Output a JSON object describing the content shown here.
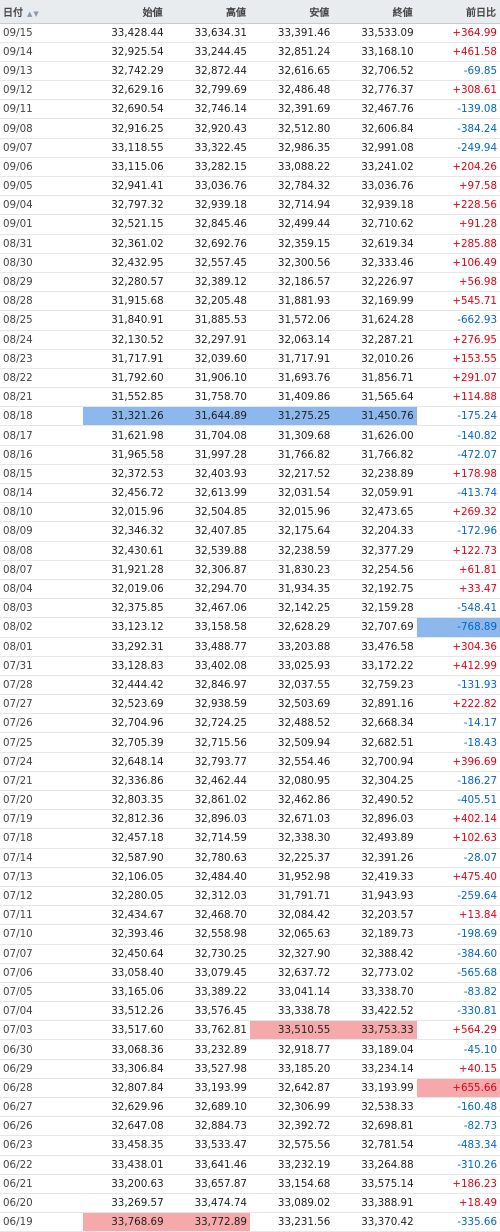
{
  "header": {
    "date": "日付",
    "open": "始値",
    "high": "高値",
    "low": "安値",
    "close": "終値",
    "change": "前日比"
  },
  "rows": [
    {
      "date": "09/15",
      "open": "33,428.44",
      "high": "33,634.31",
      "low": "33,391.46",
      "close": "33,533.09",
      "change": "+364.99"
    },
    {
      "date": "09/14",
      "open": "32,925.54",
      "high": "33,244.45",
      "low": "32,851.24",
      "close": "33,168.10",
      "change": "+461.58"
    },
    {
      "date": "09/13",
      "open": "32,742.29",
      "high": "32,872.44",
      "low": "32,616.65",
      "close": "32,706.52",
      "change": "-69.85"
    },
    {
      "date": "09/12",
      "open": "32,629.16",
      "high": "32,799.69",
      "low": "32,486.48",
      "close": "32,776.37",
      "change": "+308.61"
    },
    {
      "date": "09/11",
      "open": "32,690.54",
      "high": "32,746.14",
      "low": "32,391.69",
      "close": "32,467.76",
      "change": "-139.08"
    },
    {
      "date": "09/08",
      "open": "32,916.25",
      "high": "32,920.43",
      "low": "32,512.80",
      "close": "32,606.84",
      "change": "-384.24"
    },
    {
      "date": "09/07",
      "open": "33,118.55",
      "high": "33,322.45",
      "low": "32,986.35",
      "close": "32,991.08",
      "change": "-249.94"
    },
    {
      "date": "09/06",
      "open": "33,115.06",
      "high": "33,282.15",
      "low": "33,088.22",
      "close": "33,241.02",
      "change": "+204.26"
    },
    {
      "date": "09/05",
      "open": "32,941.41",
      "high": "33,036.76",
      "low": "32,784.32",
      "close": "33,036.76",
      "change": "+97.58"
    },
    {
      "date": "09/04",
      "open": "32,797.32",
      "high": "32,939.18",
      "low": "32,714.94",
      "close": "32,939.18",
      "change": "+228.56"
    },
    {
      "date": "09/01",
      "open": "32,521.15",
      "high": "32,845.46",
      "low": "32,499.44",
      "close": "32,710.62",
      "change": "+91.28"
    },
    {
      "date": "08/31",
      "open": "32,361.02",
      "high": "32,692.76",
      "low": "32,359.15",
      "close": "32,619.34",
      "change": "+285.88"
    },
    {
      "date": "08/30",
      "open": "32,432.95",
      "high": "32,557.45",
      "low": "32,300.56",
      "close": "32,333.46",
      "change": "+106.49"
    },
    {
      "date": "08/29",
      "open": "32,280.57",
      "high": "32,389.12",
      "low": "32,186.57",
      "close": "32,226.97",
      "change": "+56.98"
    },
    {
      "date": "08/28",
      "open": "31,915.68",
      "high": "32,205.48",
      "low": "31,881.93",
      "close": "32,169.99",
      "change": "+545.71"
    },
    {
      "date": "08/25",
      "open": "31,840.91",
      "high": "31,885.53",
      "low": "31,572.06",
      "close": "31,624.28",
      "change": "-662.93"
    },
    {
      "date": "08/24",
      "open": "32,130.52",
      "high": "32,297.91",
      "low": "32,063.14",
      "close": "32,287.21",
      "change": "+276.95"
    },
    {
      "date": "08/23",
      "open": "31,717.91",
      "high": "32,039.60",
      "low": "31,717.91",
      "close": "32,010.26",
      "change": "+153.55"
    },
    {
      "date": "08/22",
      "open": "31,792.60",
      "high": "31,906.10",
      "low": "31,693.76",
      "close": "31,856.71",
      "change": "+291.07"
    },
    {
      "date": "08/21",
      "open": "31,552.85",
      "high": "31,758.70",
      "low": "31,409.86",
      "close": "31,565.64",
      "change": "+114.88"
    },
    {
      "date": "08/18",
      "open": "31,321.26",
      "high": "31,644.89",
      "low": "31,275.25",
      "close": "31,450.76",
      "change": "-175.24",
      "hl": "blue",
      "hlcols": [
        "open",
        "high",
        "low",
        "close"
      ]
    },
    {
      "date": "08/17",
      "open": "31,621.98",
      "high": "31,704.08",
      "low": "31,309.68",
      "close": "31,626.00",
      "change": "-140.82"
    },
    {
      "date": "08/16",
      "open": "31,965.58",
      "high": "31,997.28",
      "low": "31,766.82",
      "close": "31,766.82",
      "change": "-472.07"
    },
    {
      "date": "08/15",
      "open": "32,372.53",
      "high": "32,403.93",
      "low": "32,217.52",
      "close": "32,238.89",
      "change": "+178.98"
    },
    {
      "date": "08/14",
      "open": "32,456.72",
      "high": "32,613.99",
      "low": "32,031.54",
      "close": "32,059.91",
      "change": "-413.74"
    },
    {
      "date": "08/10",
      "open": "32,015.96",
      "high": "32,504.85",
      "low": "32,015.96",
      "close": "32,473.65",
      "change": "+269.32"
    },
    {
      "date": "08/09",
      "open": "32,346.32",
      "high": "32,407.85",
      "low": "32,175.64",
      "close": "32,204.33",
      "change": "-172.96"
    },
    {
      "date": "08/08",
      "open": "32,430.61",
      "high": "32,539.88",
      "low": "32,238.59",
      "close": "32,377.29",
      "change": "+122.73"
    },
    {
      "date": "08/07",
      "open": "31,921.28",
      "high": "32,306.87",
      "low": "31,830.23",
      "close": "32,254.56",
      "change": "+61.81"
    },
    {
      "date": "08/04",
      "open": "32,019.06",
      "high": "32,294.70",
      "low": "31,934.35",
      "close": "32,192.75",
      "change": "+33.47"
    },
    {
      "date": "08/03",
      "open": "32,375.85",
      "high": "32,467.06",
      "low": "32,142.25",
      "close": "32,159.28",
      "change": "-548.41"
    },
    {
      "date": "08/02",
      "open": "33,123.12",
      "high": "33,158.58",
      "low": "32,628.29",
      "close": "32,707.69",
      "change": "-768.89",
      "hl": "blue",
      "hlcols": [
        "change"
      ]
    },
    {
      "date": "08/01",
      "open": "33,292.31",
      "high": "33,488.77",
      "low": "33,203.88",
      "close": "33,476.58",
      "change": "+304.36"
    },
    {
      "date": "07/31",
      "open": "33,128.83",
      "high": "33,402.08",
      "low": "33,025.93",
      "close": "33,172.22",
      "change": "+412.99"
    },
    {
      "date": "07/28",
      "open": "32,444.42",
      "high": "32,846.97",
      "low": "32,037.55",
      "close": "32,759.23",
      "change": "-131.93"
    },
    {
      "date": "07/27",
      "open": "32,523.69",
      "high": "32,938.59",
      "low": "32,503.69",
      "close": "32,891.16",
      "change": "+222.82"
    },
    {
      "date": "07/26",
      "open": "32,704.96",
      "high": "32,724.25",
      "low": "32,488.52",
      "close": "32,668.34",
      "change": "-14.17"
    },
    {
      "date": "07/25",
      "open": "32,705.39",
      "high": "32,715.56",
      "low": "32,509.94",
      "close": "32,682.51",
      "change": "-18.43"
    },
    {
      "date": "07/24",
      "open": "32,648.14",
      "high": "32,793.77",
      "low": "32,554.46",
      "close": "32,700.94",
      "change": "+396.69"
    },
    {
      "date": "07/21",
      "open": "32,336.86",
      "high": "32,462.44",
      "low": "32,080.95",
      "close": "32,304.25",
      "change": "-186.27"
    },
    {
      "date": "07/20",
      "open": "32,803.35",
      "high": "32,861.02",
      "low": "32,462.86",
      "close": "32,490.52",
      "change": "-405.51"
    },
    {
      "date": "07/19",
      "open": "32,812.36",
      "high": "32,896.03",
      "low": "32,671.03",
      "close": "32,896.03",
      "change": "+402.14"
    },
    {
      "date": "07/18",
      "open": "32,457.18",
      "high": "32,714.59",
      "low": "32,338.30",
      "close": "32,493.89",
      "change": "+102.63"
    },
    {
      "date": "07/14",
      "open": "32,587.90",
      "high": "32,780.63",
      "low": "32,225.37",
      "close": "32,391.26",
      "change": "-28.07"
    },
    {
      "date": "07/13",
      "open": "32,106.05",
      "high": "32,484.40",
      "low": "31,952.98",
      "close": "32,419.33",
      "change": "+475.40"
    },
    {
      "date": "07/12",
      "open": "32,280.05",
      "high": "32,312.03",
      "low": "31,791.71",
      "close": "31,943.93",
      "change": "-259.64"
    },
    {
      "date": "07/11",
      "open": "32,434.67",
      "high": "32,468.70",
      "low": "32,084.42",
      "close": "32,203.57",
      "change": "+13.84"
    },
    {
      "date": "07/10",
      "open": "32,393.46",
      "high": "32,558.98",
      "low": "32,065.63",
      "close": "32,189.73",
      "change": "-198.69"
    },
    {
      "date": "07/07",
      "open": "32,450.64",
      "high": "32,730.25",
      "low": "32,327.90",
      "close": "32,388.42",
      "change": "-384.60"
    },
    {
      "date": "07/06",
      "open": "33,058.40",
      "high": "33,079.45",
      "low": "32,637.72",
      "close": "32,773.02",
      "change": "-565.68"
    },
    {
      "date": "07/05",
      "open": "33,165.06",
      "high": "33,389.22",
      "low": "33,041.14",
      "close": "33,338.70",
      "change": "-83.82"
    },
    {
      "date": "07/04",
      "open": "33,512.26",
      "high": "33,576.45",
      "low": "33,338.78",
      "close": "33,422.52",
      "change": "-330.81"
    },
    {
      "date": "07/03",
      "open": "33,517.60",
      "high": "33,762.81",
      "low": "33,510.55",
      "close": "33,753.33",
      "change": "+564.29",
      "hl": "red",
      "hlcols": [
        "low",
        "close"
      ]
    },
    {
      "date": "06/30",
      "open": "33,068.36",
      "high": "33,232.89",
      "low": "32,918.77",
      "close": "33,189.04",
      "change": "-45.10"
    },
    {
      "date": "06/29",
      "open": "33,306.84",
      "high": "33,527.98",
      "low": "33,185.20",
      "close": "33,234.14",
      "change": "+40.15"
    },
    {
      "date": "06/28",
      "open": "32,807.84",
      "high": "33,193.99",
      "low": "32,642.87",
      "close": "33,193.99",
      "change": "+655.66",
      "hl": "red",
      "hlcols": [
        "change"
      ]
    },
    {
      "date": "06/27",
      "open": "32,629.96",
      "high": "32,689.10",
      "low": "32,306.99",
      "close": "32,538.33",
      "change": "-160.48"
    },
    {
      "date": "06/26",
      "open": "32,647.08",
      "high": "32,884.73",
      "low": "32,392.72",
      "close": "32,698.81",
      "change": "-82.73"
    },
    {
      "date": "06/23",
      "open": "33,458.35",
      "high": "33,533.47",
      "low": "32,575.56",
      "close": "32,781.54",
      "change": "-483.34"
    },
    {
      "date": "06/22",
      "open": "33,438.01",
      "high": "33,641.46",
      "low": "33,232.19",
      "close": "33,264.88",
      "change": "-310.26"
    },
    {
      "date": "06/21",
      "open": "33,200.63",
      "high": "33,657.87",
      "low": "33,154.68",
      "close": "33,575.14",
      "change": "+186.23"
    },
    {
      "date": "06/20",
      "open": "33,269.57",
      "high": "33,474.74",
      "low": "33,089.02",
      "close": "33,388.91",
      "change": "+18.49"
    },
    {
      "date": "06/19",
      "open": "33,768.69",
      "high": "33,772.89",
      "low": "33,231.56",
      "close": "33,370.42",
      "change": "-335.66",
      "hl": "red",
      "hlcols": [
        "open",
        "high"
      ]
    }
  ]
}
